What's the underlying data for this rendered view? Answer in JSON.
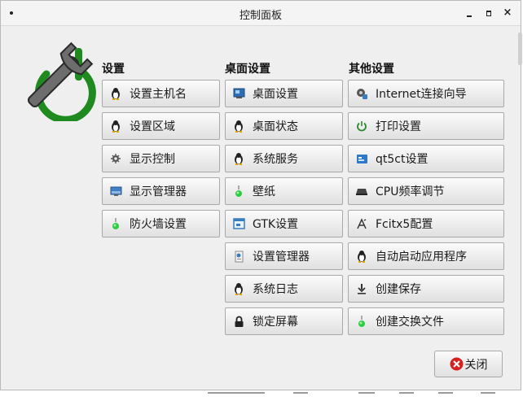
{
  "window": {
    "title": "控制面板",
    "close_glyph": "×"
  },
  "columns": [
    {
      "heading": "设置",
      "buttons": [
        {
          "label": "设置主机名",
          "icon": "tux-icon"
        },
        {
          "label": "设置区域",
          "icon": "tux-icon"
        },
        {
          "label": "显示控制",
          "icon": "display-gear-icon"
        },
        {
          "label": "显示管理器",
          "icon": "monitor-icon"
        },
        {
          "label": "防火墙设置",
          "icon": "flask-icon"
        }
      ]
    },
    {
      "heading": "桌面设置",
      "buttons": [
        {
          "label": "桌面设置",
          "icon": "desktop-icon"
        },
        {
          "label": "桌面状态",
          "icon": "tux-icon"
        },
        {
          "label": "系统服务",
          "icon": "tux-icon"
        },
        {
          "label": "壁纸",
          "icon": "flask-icon"
        },
        {
          "label": "GTK设置",
          "icon": "gtk-window-icon"
        },
        {
          "label": "设置管理器",
          "icon": "settings-doc-icon"
        },
        {
          "label": "系统日志",
          "icon": "tux-icon"
        },
        {
          "label": "锁定屏幕",
          "icon": "lock-icon"
        }
      ]
    },
    {
      "heading": "其他设置",
      "buttons": [
        {
          "label": "Internet连接向导",
          "icon": "network-wizard-icon"
        },
        {
          "label": "打印设置",
          "icon": "power-icon"
        },
        {
          "label": "qt5ct设置",
          "icon": "qt-window-icon"
        },
        {
          "label": "CPU频率调节",
          "icon": "cpu-icon"
        },
        {
          "label": "Fcitx5配置",
          "icon": "keyboard-pen-icon"
        },
        {
          "label": "自动启动应用程序",
          "icon": "tux-icon"
        },
        {
          "label": "创建保存",
          "icon": "download-icon"
        },
        {
          "label": "创建交换文件",
          "icon": "flask-icon"
        }
      ]
    }
  ],
  "footer": {
    "close_label": "关闭",
    "close_icon": "red-x-icon"
  },
  "colors": {
    "logo_green": "#1f8a1f",
    "logo_grey": "#6d6d6d",
    "close_red": "#d62020"
  }
}
